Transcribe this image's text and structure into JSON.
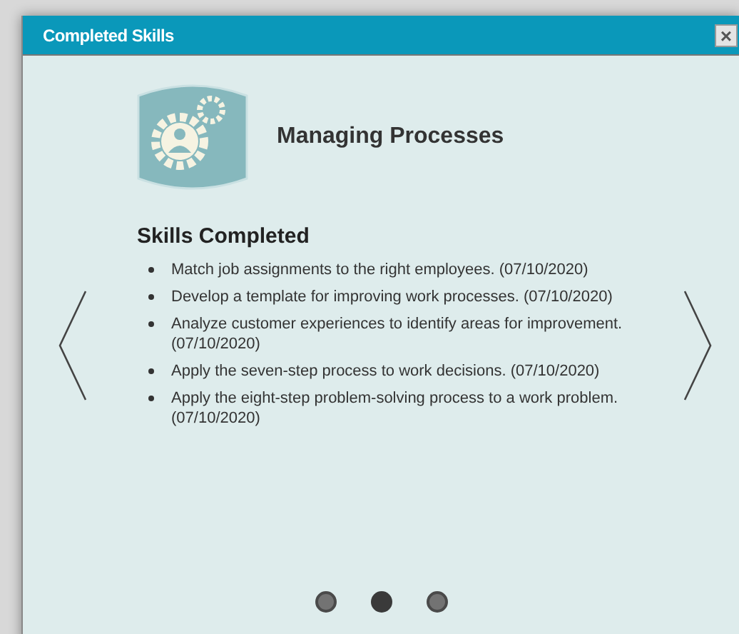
{
  "window": {
    "title": "Completed Skills",
    "close": "×"
  },
  "course": {
    "title": "Managing Processes"
  },
  "section": {
    "heading": "Skills Completed"
  },
  "skills": [
    "Match job assignments to the right employees. (07/10/2020)",
    "Develop a template for improving work processes. (07/10/2020)",
    "Analyze customer experiences to identify areas for improvement. (07/10/2020)",
    "Apply the seven-step process to work decisions. (07/10/2020)",
    "Apply the eight-step problem-solving process to a work problem. (07/10/2020)"
  ],
  "pager": [
    {
      "selected": false
    },
    {
      "selected": true
    },
    {
      "selected": false
    }
  ]
}
